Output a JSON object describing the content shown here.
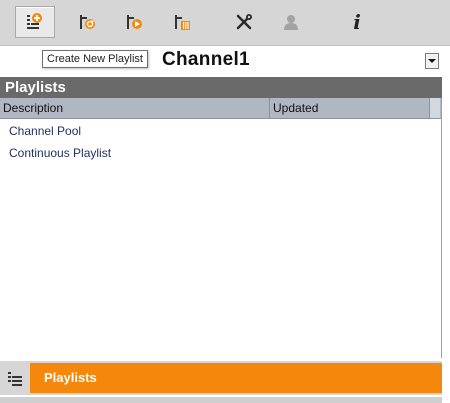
{
  "toolbar": {
    "buttons": [
      {
        "icon": "create-playlist-icon",
        "active": true
      },
      {
        "icon": "refresh-playlist-icon",
        "active": false
      },
      {
        "icon": "play-playlist-icon",
        "active": false
      },
      {
        "icon": "delete-playlist-icon",
        "active": false
      },
      {
        "icon": "tools-icon",
        "active": false
      },
      {
        "icon": "user-icon",
        "active": false
      },
      {
        "icon": "info-icon",
        "active": false
      }
    ],
    "tooltip": "Create New Playlist",
    "info_glyph": "i"
  },
  "channel": {
    "name": "Channel1"
  },
  "section": {
    "title": "Playlists"
  },
  "grid": {
    "columns": [
      "Description",
      "Updated"
    ],
    "rows": [
      {
        "description": "Channel Pool",
        "updated": ""
      },
      {
        "description": "Continuous Playlist",
        "updated": ""
      }
    ]
  },
  "bottom_tab": {
    "label": "Playlists"
  },
  "colors": {
    "accent": "#f5870c",
    "toolbar_bg": "#d6d6d6",
    "section_header_bg": "#6a6a6a",
    "grid_header_bg": "#b0b6c2",
    "row_text": "#1c2f5c"
  }
}
